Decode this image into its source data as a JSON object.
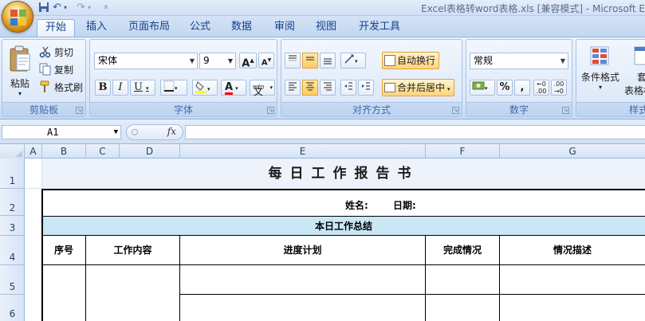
{
  "title_bar": {
    "window_title": "Excel表格转word表格.xls  [兼容模式] - Microsoft E"
  },
  "tabs": [
    "开始",
    "插入",
    "页面布局",
    "公式",
    "数据",
    "审阅",
    "视图",
    "开发工具"
  ],
  "ribbon": {
    "clipboard": {
      "paste": "粘贴",
      "cut": "剪切",
      "copy": "复制",
      "format_painter": "格式刷",
      "label": "剪贴板"
    },
    "font": {
      "font_name": "宋体",
      "font_size": "9",
      "label": "字体"
    },
    "alignment": {
      "wrap_text": "自动换行",
      "merge_center": "合并后居中",
      "label": "对齐方式"
    },
    "number": {
      "format": "常规",
      "label": "数字"
    },
    "styles": {
      "conditional_formatting": "条件格式",
      "table_format_partial": "套",
      "table_format_partial_2": "表格格",
      "label_partial": "样式"
    }
  },
  "formula_bar": {
    "name_box": "A1",
    "fx": "fx",
    "value": ""
  },
  "columns": [
    "A",
    "B",
    "C",
    "D",
    "E",
    "F",
    "G"
  ],
  "rows": [
    "1",
    "2",
    "3",
    "4",
    "5",
    "6"
  ],
  "sheet": {
    "title": "每日工作报告书",
    "name_label": "姓名:",
    "date_label": "日期:",
    "summary": "本日工作总结",
    "headers": [
      "序号",
      "工作内容",
      "进度计划",
      "完成情况",
      "情况描述"
    ]
  },
  "colors": {
    "ribbon_blue": "#dce8f8",
    "accent_text": "#15428b",
    "summary_fill": "#c9e7f5",
    "highlight_orange": "#ffd47a"
  }
}
